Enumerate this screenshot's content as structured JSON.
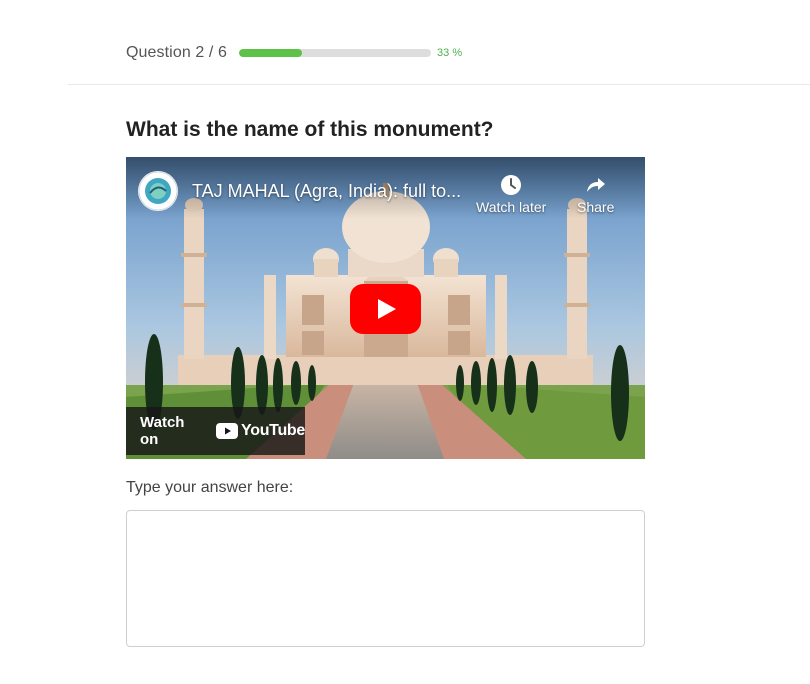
{
  "quiz": {
    "counter": "Question 2 / 6",
    "progress_fraction": 0.33,
    "progress_label": "33 %",
    "accent_color": "#5dc14a"
  },
  "question": {
    "text": "What is the name of this monument?"
  },
  "video": {
    "title": "TAJ MAHAL (Agra, India): full to...",
    "watch_later_label": "Watch later",
    "share_label": "Share",
    "watch_on_label": "Watch on",
    "youtube_wordmark": "YouTube",
    "play_color": "#ff0000",
    "icons": [
      "channel-logo",
      "clock-icon",
      "share-icon",
      "play-icon",
      "youtube-logo-icon"
    ]
  },
  "answer": {
    "label": "Type your answer here:",
    "value": "",
    "placeholder": ""
  }
}
